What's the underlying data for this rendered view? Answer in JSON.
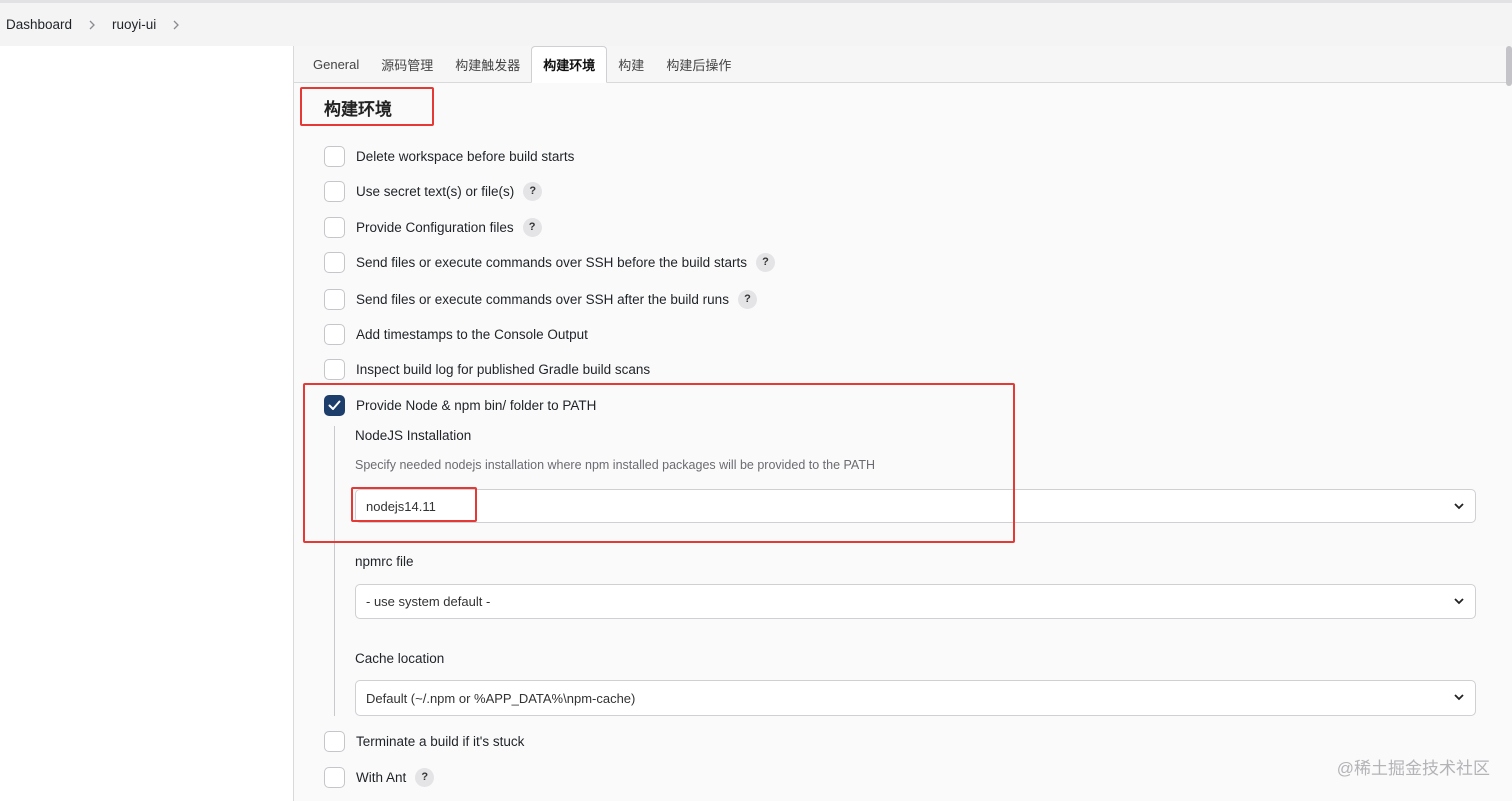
{
  "breadcrumb": {
    "items": [
      "Dashboard",
      "ruoyi-ui"
    ]
  },
  "tabs": [
    {
      "label": "General"
    },
    {
      "label": "源码管理"
    },
    {
      "label": "构建触发器"
    },
    {
      "label": "构建环境",
      "active": true
    },
    {
      "label": "构建"
    },
    {
      "label": "构建后操作"
    }
  ],
  "section": {
    "title": "构建环境"
  },
  "options": [
    {
      "label": "Delete workspace before build starts",
      "checked": false,
      "help": false
    },
    {
      "label": "Use secret text(s) or file(s)",
      "checked": false,
      "help": true
    },
    {
      "label": "Provide Configuration files",
      "checked": false,
      "help": true
    },
    {
      "label": "Send files or execute commands over SSH before the build starts",
      "checked": false,
      "help": true
    },
    {
      "label": "Send files or execute commands over SSH after the build runs",
      "checked": false,
      "help": true
    },
    {
      "label": "Add timestamps to the Console Output",
      "checked": false,
      "help": false
    },
    {
      "label": "Inspect build log for published Gradle build scans",
      "checked": false,
      "help": false
    },
    {
      "label": "Provide Node & npm bin/ folder to PATH",
      "checked": true,
      "help": false
    },
    {
      "label": "Terminate a build if it's stuck",
      "checked": false,
      "help": false
    },
    {
      "label": "With Ant",
      "checked": false,
      "help": true
    }
  ],
  "node": {
    "installation_label": "NodeJS Installation",
    "installation_desc": "Specify needed nodejs installation where npm installed packages will be provided to the PATH",
    "installation_value": "nodejs14.11",
    "npmrc_label": "npmrc file",
    "npmrc_value": "- use system default -",
    "cache_label": "Cache location",
    "cache_value": "Default (~/.npm or %APP_DATA%\\npm-cache)"
  },
  "help_glyph": "?",
  "watermark": "@稀土掘金技术社区",
  "colors": {
    "checked": "#1d3d6b",
    "highlight": "#e53935"
  }
}
